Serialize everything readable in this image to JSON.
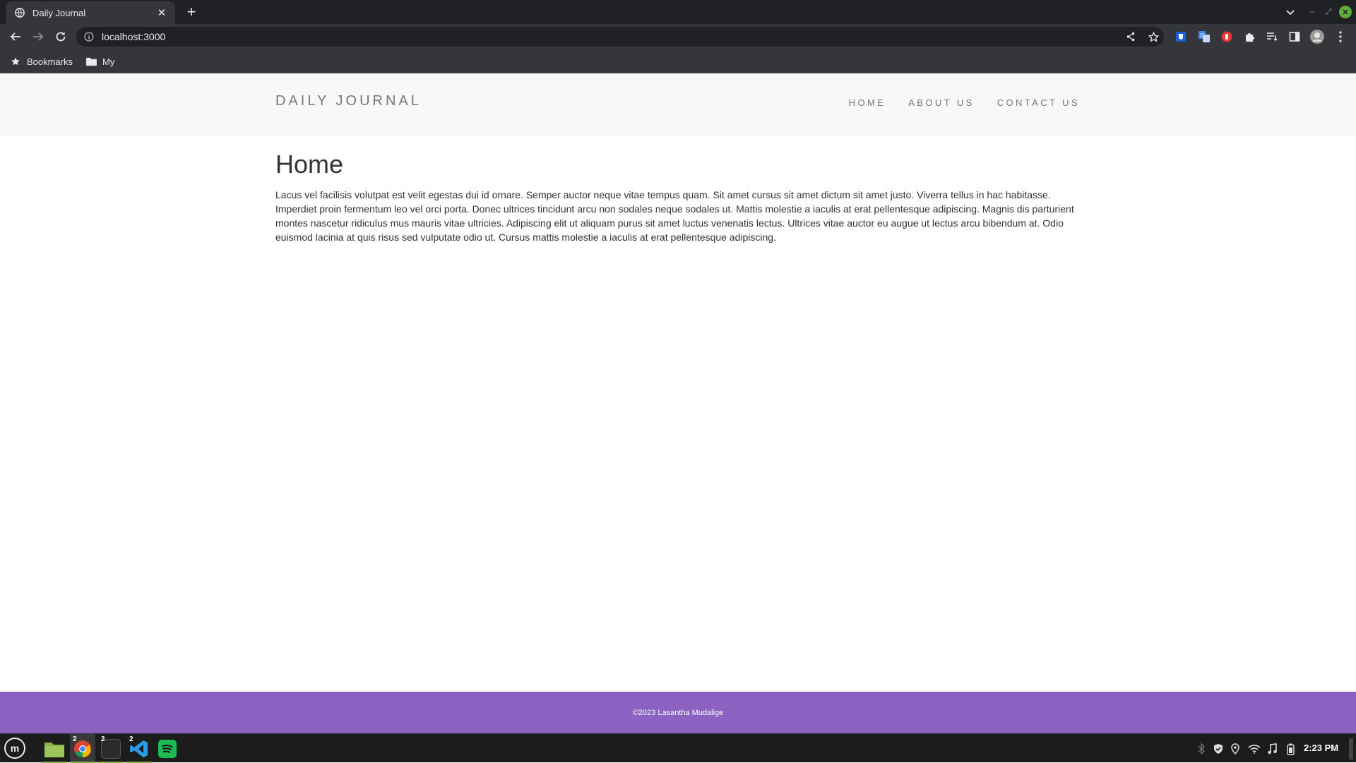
{
  "browser": {
    "tab_title": "Daily Journal",
    "url": "localhost:3000",
    "bookmarks": [
      {
        "label": "Bookmarks",
        "icon": "star-icon"
      },
      {
        "label": "My",
        "icon": "folder-icon"
      }
    ]
  },
  "site": {
    "brand": "DAILY JOURNAL",
    "nav": [
      "HOME",
      "ABOUT US",
      "CONTACT US"
    ],
    "heading": "Home",
    "body": "Lacus vel facilisis volutpat est velit egestas dui id ornare. Semper auctor neque vitae tempus quam. Sit amet cursus sit amet dictum sit amet justo. Viverra tellus in hac habitasse. Imperdiet proin fermentum leo vel orci porta. Donec ultrices tincidunt arcu non sodales neque sodales ut. Mattis molestie a iaculis at erat pellentesque adipiscing. Magnis dis parturient montes nascetur ridiculus mus mauris vitae ultricies. Adipiscing elit ut aliquam purus sit amet luctus venenatis lectus. Ultrices vitae auctor eu augue ut lectus arcu bibendum at. Odio euismod lacinia at quis risus sed vulputate odio ut. Cursus mattis molestie a iaculis at erat pellentesque adipiscing.",
    "footer": "©2023 Lasantha Mudalige"
  },
  "taskbar": {
    "apps": [
      {
        "name": "files",
        "count": ""
      },
      {
        "name": "chrome",
        "count": "2"
      },
      {
        "name": "terminal",
        "count": "2"
      },
      {
        "name": "vscode",
        "count": "2"
      },
      {
        "name": "spotify",
        "count": ""
      }
    ],
    "clock": "2:23 PM"
  },
  "colors": {
    "footer_bg": "#8b62c1",
    "nav_bg": "#f8f8f8",
    "chrome_dark": "#202124",
    "chrome_toolbar": "#35363a"
  }
}
